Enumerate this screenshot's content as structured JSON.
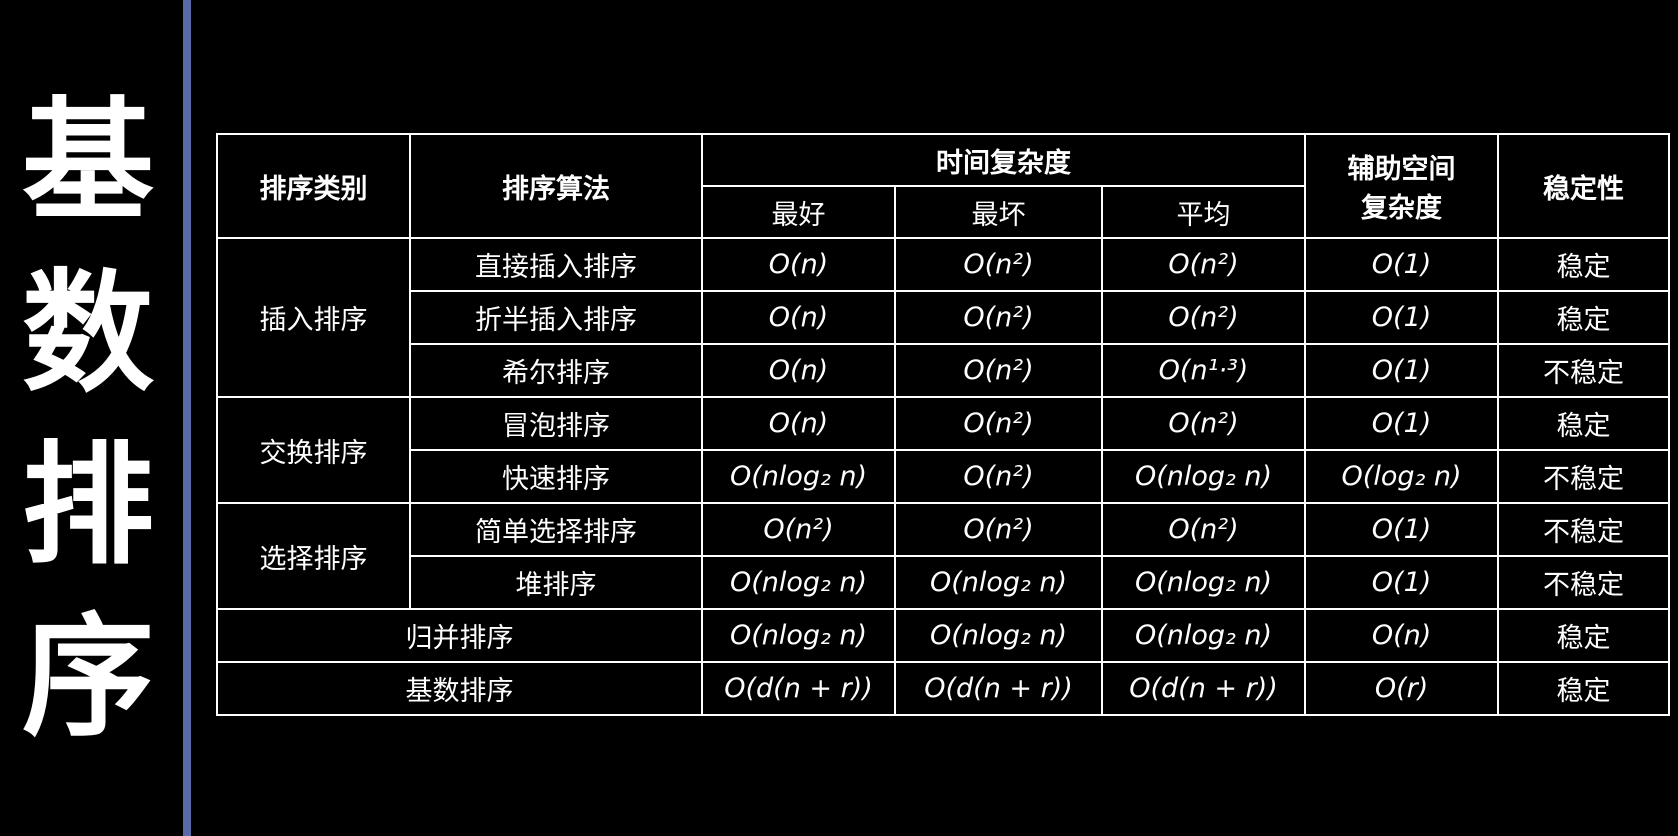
{
  "side_title": [
    "基",
    "数",
    "排",
    "序"
  ],
  "headers": {
    "category": "排序类别",
    "algorithm": "排序算法",
    "time_complexity": "时间复杂度",
    "best": "最好",
    "worst": "最坏",
    "average": "平均",
    "space_line1": "辅助空间",
    "space_line2": "复杂度",
    "stability": "稳定性"
  },
  "categories": {
    "insertion": "插入排序",
    "exchange": "交换排序",
    "selection": "选择排序"
  },
  "rows": [
    {
      "algorithm": "直接插入排序",
      "best": "O(n)",
      "worst": "O(n²)",
      "average": "O(n²)",
      "space": "O(1)",
      "stability": "稳定"
    },
    {
      "algorithm": "折半插入排序",
      "best": "O(n)",
      "worst": "O(n²)",
      "average": "O(n²)",
      "space": "O(1)",
      "stability": "稳定"
    },
    {
      "algorithm": "希尔排序",
      "best": "O(n)",
      "worst": "O(n²)",
      "average": "O(n¹·³)",
      "space": "O(1)",
      "stability": "不稳定"
    },
    {
      "algorithm": "冒泡排序",
      "best": "O(n)",
      "worst": "O(n²)",
      "average": "O(n²)",
      "space": "O(1)",
      "stability": "稳定"
    },
    {
      "algorithm": "快速排序",
      "best": "O(nlog₂ n)",
      "worst": "O(n²)",
      "average": "O(nlog₂ n)",
      "space": "O(log₂ n)",
      "stability": "不稳定"
    },
    {
      "algorithm": "简单选择排序",
      "best": "O(n²)",
      "worst": "O(n²)",
      "average": "O(n²)",
      "space": "O(1)",
      "stability": "不稳定"
    },
    {
      "algorithm": "堆排序",
      "best": "O(nlog₂ n)",
      "worst": "O(nlog₂ n)",
      "average": "O(nlog₂ n)",
      "space": "O(1)",
      "stability": "不稳定"
    },
    {
      "algorithm": "归并排序",
      "best": "O(nlog₂ n)",
      "worst": "O(nlog₂ n)",
      "average": "O(nlog₂ n)",
      "space": "O(n)",
      "stability": "稳定"
    },
    {
      "algorithm": "基数排序",
      "best": "O(d(n + r))",
      "worst": "O(d(n + r))",
      "average": "O(d(n + r))",
      "space": "O(r)",
      "stability": "稳定"
    }
  ],
  "colors": {
    "background": "#000000",
    "text": "#ffffff",
    "divider": "#5a6aa8"
  }
}
